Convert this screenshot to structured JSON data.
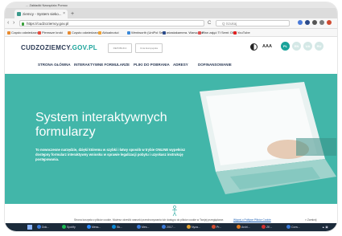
{
  "browser": {
    "menubar": "...  Zakładki  Narzędzia  Pomoc",
    "tab_title": "ziemcy - System sieko...",
    "tab_close": "×",
    "new_tab": "+",
    "nav_back": "‹",
    "nav_forward": "›",
    "reload": "C",
    "url": "https://cudzoziemcy.gov.pl",
    "search_placeholder": "Q Szukaj",
    "bookmarks": [
      {
        "label": "Często odwiedzane",
        "color": "#e88a2f"
      },
      {
        "label": "Pierwsze kroki",
        "color": "#ea4a3a"
      },
      {
        "label": "Często odwiedzane",
        "color": "#e88a2f"
      },
      {
        "label": "Aktualności",
        "color": "#f0a030"
      },
      {
        "label": "Wentworth (UniPol Serv...",
        "color": "#3a88d8"
      },
      {
        "label": "miastakamera. Warszawa",
        "color": "#2a4a8a"
      },
      {
        "label": "Plan zajęć Tł Semi: Dłu...",
        "color": "#e05050"
      },
      {
        "label": "YouTube",
        "color": "#e02020"
      }
    ]
  },
  "site": {
    "logo_main": "CUDZOZIEMCY.",
    "logo_gov": "GOV.PL",
    "partner_1": "REPUBLIKA",
    "partner_2": "Unia Europejska",
    "font_size": "AAA",
    "languages": [
      {
        "code": "PL",
        "active": true
      },
      {
        "code": "EN",
        "active": false
      },
      {
        "code": "UA",
        "active": false
      },
      {
        "code": "RU",
        "active": false
      }
    ],
    "nav": [
      "STRONA GŁÓWNA",
      "INTERAKTYWNE FORMULARZE",
      "PLIKI DO POBRANIA",
      "ADRESY",
      "DOFINANSOWANIE"
    ]
  },
  "hero": {
    "title": "System interaktywnych formularzy",
    "description": "To nowoczesne narzędzie, dzięki któremu w szybki i łatwy sposób w trybie ONLINE wypełnisz dostępny formularz interaktywny wniosku w sprawie legalizacji pobytu i uzyskasz instrukcję postępowania."
  },
  "cookie_bar": {
    "text": "Strona korzysta z plików cookie. Możesz określić warunki przechowywania lub dostępu do plików cookie w Twojej przeglądarce.",
    "link": "Więcej o Polityce Plików Cookie",
    "close": "× Zamknij"
  },
  "taskbar": {
    "items": [
      {
        "label": "Dok...",
        "color": "#3a7ad8"
      },
      {
        "label": "Spotify",
        "color": "#1db954"
      },
      {
        "label": "Mess...",
        "color": "#2a8aff"
      },
      {
        "label": "Sk...",
        "color": "#0a8ad8"
      },
      {
        "label": "Mes...",
        "color": "#3a7ad8"
      },
      {
        "label": "2017...",
        "color": "#3a7ad8"
      },
      {
        "label": "Nyza...",
        "color": "#e0a030"
      },
      {
        "label": "Pr...",
        "color": "#d04a30"
      },
      {
        "label": "Archi...",
        "color": "#e07a20"
      },
      {
        "label": "ZE...",
        "color": "#d03030"
      },
      {
        "label": "Conv...",
        "color": "#3a7ad8"
      }
    ]
  },
  "colors": {
    "accent": "#19a39a",
    "hero_bg": "#42b6a9",
    "logo_text": "#2b3a55"
  }
}
